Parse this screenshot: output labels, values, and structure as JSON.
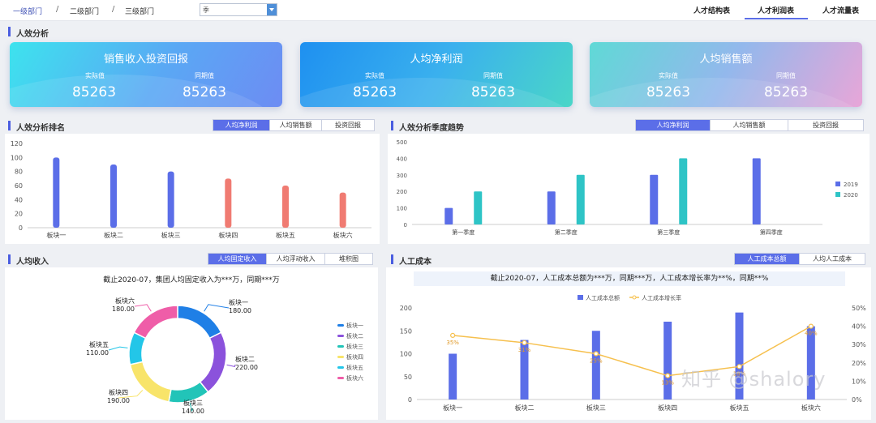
{
  "breadcrumb": [
    "一级部门",
    "二级部门",
    "三级部门"
  ],
  "separator": "/",
  "select": {
    "value": "季"
  },
  "top_tabs": [
    "人才结构表",
    "人才利润表",
    "人才流量表"
  ],
  "sections": {
    "efficiency": "人效分析",
    "ranking": "人效分析排名",
    "trend": "人效分析季度趋势",
    "income": "人均收入",
    "labor": "人工成本"
  },
  "cards": [
    {
      "title": "销售收入投资回报",
      "actual_label": "实际值",
      "actual": "85263",
      "compare_label": "同期值",
      "compare": "85263"
    },
    {
      "title": "人均净利润",
      "actual_label": "实际值",
      "actual": "85263",
      "compare_label": "同期值",
      "compare": "85263"
    },
    {
      "title": "人均销售额",
      "actual_label": "实际值",
      "actual": "85263",
      "compare_label": "同期值",
      "compare": "85263"
    }
  ],
  "ranking_tabs": [
    "人均净利润",
    "人均销售额",
    "投资回报"
  ],
  "trend_tabs": [
    "人均净利润",
    "人均销售额",
    "投资回报"
  ],
  "income_tabs": [
    "人均固定收入",
    "人均浮动收入",
    "堆积图"
  ],
  "labor_tabs": [
    "人工成本总额",
    "人均人工成本"
  ],
  "income_note": "截止2020-07，集团人均固定收入为***万，同期***万",
  "labor_note": "截止2020-07，人工成本总额为***万，同期***万，人工成本增长率为**%，同期**%",
  "watermark": "知乎 @shalory",
  "colors": {
    "blue": "#5b6ee8",
    "salmon": "#f07b72",
    "teal": "#2ec4c6",
    "orange": "#f6c04e"
  },
  "chart_data": [
    {
      "type": "bar",
      "categories": [
        "板块一",
        "板块二",
        "板块三",
        "板块四",
        "板块五",
        "板块六"
      ],
      "values": [
        100,
        90,
        80,
        70,
        60,
        50
      ],
      "ylim": [
        0,
        120
      ],
      "yticks": [
        0,
        20,
        40,
        60,
        80,
        100,
        120
      ],
      "highlight_colors": [
        "#5b6ee8",
        "#5b6ee8",
        "#5b6ee8",
        "#f07b72",
        "#f07b72",
        "#f07b72"
      ]
    },
    {
      "type": "bar",
      "categories": [
        "第一季度",
        "第二季度",
        "第三季度",
        "第四季度"
      ],
      "series": [
        {
          "name": "2019",
          "values": [
            100,
            200,
            300,
            400
          ],
          "color": "#5b6ee8"
        },
        {
          "name": "2020",
          "values": [
            200,
            300,
            400,
            null
          ],
          "color": "#2ec4c6"
        }
      ],
      "ylim": [
        0,
        500
      ],
      "yticks": [
        0,
        100,
        200,
        300,
        400,
        500
      ],
      "legend": "right"
    },
    {
      "type": "pie",
      "donut": true,
      "slices": [
        {
          "name": "板块一",
          "value": 180.0,
          "value_label": "180.00",
          "color": "#1f7fe6"
        },
        {
          "name": "板块二",
          "value": 220.0,
          "value_label": "220.00",
          "color": "#8b52dc"
        },
        {
          "name": "板块三",
          "value": 140.0,
          "value_label": "140.00",
          "color": "#22c4b8"
        },
        {
          "name": "板块四",
          "value": 190.0,
          "value_label": "190.00",
          "color": "#f8e46a"
        },
        {
          "name": "板块五",
          "value": 110.0,
          "value_label": "110.00",
          "color": "#23c6e8"
        },
        {
          "name": "板块六",
          "value": 180.0,
          "value_label": "180.00",
          "color": "#ef5da8"
        }
      ],
      "legend": "right"
    },
    {
      "type": "bar",
      "categories": [
        "板块一",
        "板块二",
        "板块三",
        "板块四",
        "板块五",
        "板块六"
      ],
      "bar_series": {
        "name": "人工成本总额",
        "values": [
          100,
          130,
          150,
          170,
          190,
          160
        ],
        "color": "#5b6ee8"
      },
      "line_series": {
        "name": "人工成本增长率",
        "values": [
          35,
          31,
          25,
          13,
          18,
          40
        ],
        "labels": [
          "35%",
          "31%",
          "25%",
          "13%",
          "18%",
          "40%"
        ],
        "color": "#f6c04e"
      },
      "ylim": [
        0,
        200
      ],
      "yticks": [
        0,
        50,
        100,
        150,
        200
      ],
      "y2lim": [
        0,
        50
      ],
      "y2ticks": [
        "0%",
        "10%",
        "20%",
        "30%",
        "40%",
        "50%"
      ],
      "legend": "top"
    }
  ]
}
